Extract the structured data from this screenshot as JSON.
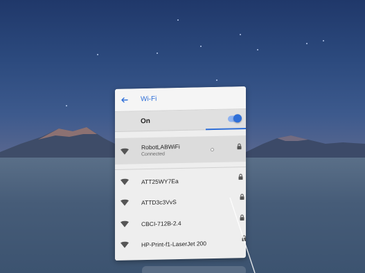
{
  "header": {
    "title": "Wi-Fi",
    "back_icon": "arrow-left-icon"
  },
  "wifi_toggle": {
    "label": "On",
    "state": true
  },
  "networks": [
    {
      "name": "RobotLABWiFi",
      "status": "Connected",
      "secured": true
    },
    {
      "name": "ATT25WY7Ea",
      "status": "",
      "secured": true
    },
    {
      "name": "ATTD3c3VvS",
      "status": "",
      "secured": true
    },
    {
      "name": "CBCI-712B-2.4",
      "status": "",
      "secured": true
    },
    {
      "name": "HP-Print-f1-LaserJet 200",
      "status": "",
      "secured": true
    }
  ],
  "colors": {
    "accent": "#2f6fd8",
    "panel_bg": "#eeeeee",
    "connected_bg": "#dcdcdc"
  }
}
